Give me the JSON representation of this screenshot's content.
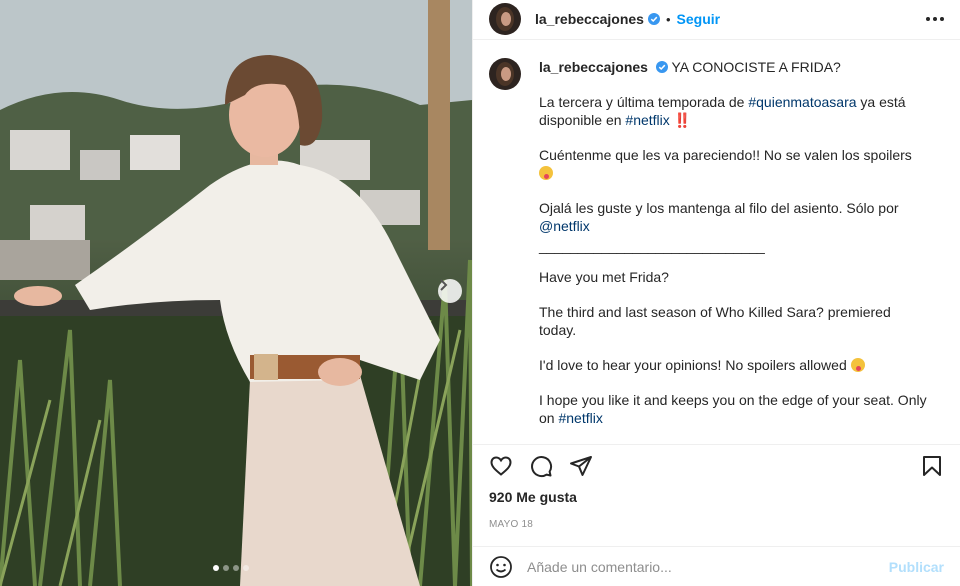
{
  "photo": {
    "alt_icon": "chevron-right-icon",
    "carousel_dots": 4,
    "active_dot": 0
  },
  "header": {
    "username": "la_rebeccajones",
    "separator": "•",
    "follow_label": "Seguir",
    "more_icon": "more-horizontal-icon"
  },
  "caption": {
    "username": "la_rebeccajones",
    "title": "YA CONOCISTE A FRIDA?",
    "p1_before": "La tercera y última temporada de ",
    "p1_tag1": "#quienmatoasara",
    "p1_middle": " ya está disponible en ",
    "p1_tag2": "#netflix",
    "p1_after": " ‼️",
    "p2": "Cuéntenme que les va pareciendo!! No se valen los spoilers ",
    "p3_before": "Ojalá les guste y los mantenga al filo del asiento. Sólo por ",
    "p3_mention": "@netflix",
    "divider": "_____________________________",
    "p4": "Have you met Frida?",
    "p5": "The third and last season of Who Killed Sara? premiered today.",
    "p6": "I'd love to hear your opinions! No spoilers allowed ",
    "p7_before": "I hope you like it and keeps you on the edge of your seat. Only on ",
    "p7_tag": "#netflix"
  },
  "actions": {
    "like_icon": "heart-icon",
    "comment_icon": "comment-icon",
    "share_icon": "share-icon",
    "save_icon": "bookmark-icon"
  },
  "likes": "920 Me gusta",
  "date": "MAYO 18",
  "comment_box": {
    "emoji_icon": "emoji-icon",
    "placeholder": "Añade un comentario...",
    "publish_label": "Publicar"
  },
  "colors": {
    "link": "#0095f6",
    "hashtag": "#00376b",
    "publish_disabled": "#b2dffc",
    "verified": "#3897f0"
  }
}
